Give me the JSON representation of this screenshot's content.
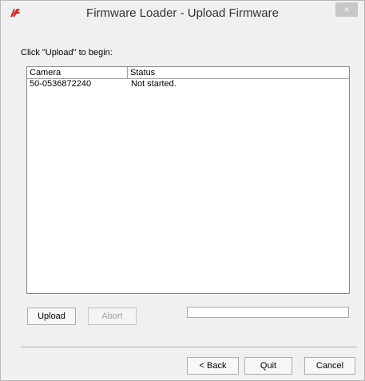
{
  "window": {
    "title": "Firmware Loader - Upload Firmware",
    "close_glyph": "×",
    "icon": "app-logo-icon",
    "accent_color": "#d42020"
  },
  "instruction": "Click \"Upload\" to begin:",
  "camera_list": {
    "columns": [
      "Camera",
      "Status"
    ],
    "rows": [
      {
        "camera": "50-0536872240",
        "status": "Not started."
      }
    ]
  },
  "actions": {
    "upload_label": "Upload",
    "abort_label": "Abort",
    "progress_fraction": 0
  },
  "footer": {
    "back_label": "< Back",
    "quit_label": "Quit",
    "cancel_label": "Cancel"
  }
}
